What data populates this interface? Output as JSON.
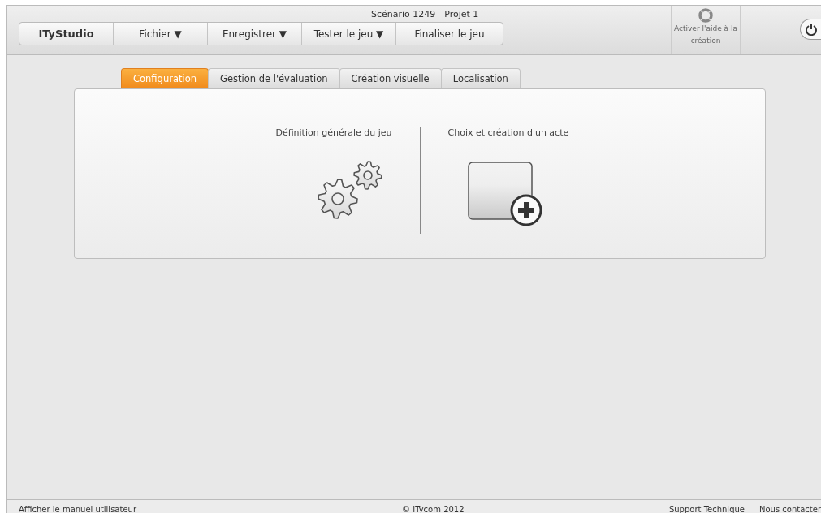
{
  "window": {
    "title": "Scénario 1249 - Projet 1"
  },
  "menu": [
    {
      "label": "ITyStudio",
      "kind": "brand"
    },
    {
      "label": "Fichier ▼",
      "kind": "item"
    },
    {
      "label": "Enregistrer ▼",
      "kind": "item"
    },
    {
      "label": "Tester le jeu ▼",
      "kind": "item"
    },
    {
      "label": "Finaliser le jeu",
      "kind": "item"
    }
  ],
  "help_button": {
    "label": "Activer l'aide à la création"
  },
  "tabs": [
    {
      "label": "Configuration",
      "selected": true
    },
    {
      "label": "Gestion de l'évaluation",
      "selected": false
    },
    {
      "label": "Création visuelle",
      "selected": false
    },
    {
      "label": "Localisation",
      "selected": false
    }
  ],
  "sections": [
    {
      "title": "Définition générale du jeu",
      "kind": "gears"
    },
    {
      "title": "Choix et création d'un acte",
      "kind": "new-act"
    }
  ],
  "footer": {
    "manual_link": "Afficher le manuel utilisateur",
    "copyright": "© ITycom 2012",
    "support_link": "Support Technique",
    "contact_link": "Nous contacter"
  }
}
